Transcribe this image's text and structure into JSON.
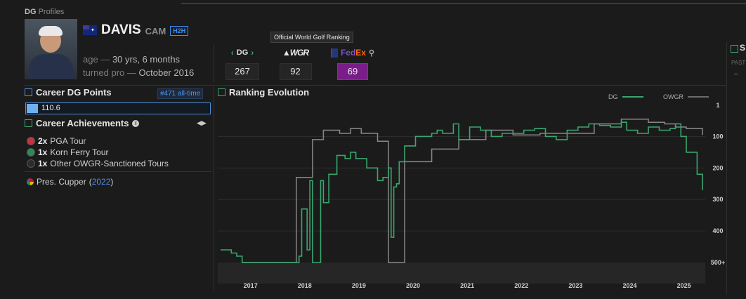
{
  "breadcrumb": {
    "prefix": "DG",
    "label": "Profiles"
  },
  "player": {
    "last_name": "DAVIS",
    "first_name": "CAM",
    "h2h_label": "H2H",
    "age_label": "age",
    "age_value": "30 yrs, 6 months",
    "pro_label": "turned pro",
    "pro_value": "October 2016"
  },
  "tooltip": "Official World Golf Ranking",
  "rankings": {
    "dg": {
      "label": "DG",
      "value": "267"
    },
    "owgr": {
      "label": "WGR",
      "value": "92"
    },
    "fedex": {
      "label_fe": "Fed",
      "label_ex": "Ex",
      "value": "69",
      "color": "#7a1d8a"
    }
  },
  "right_stub": {
    "title": "S",
    "past": "PAST",
    "dash": "–"
  },
  "career_points": {
    "title": "Career DG Points",
    "rank": "#471 all-time",
    "value": "110.6",
    "fill_fraction": 0.06
  },
  "achievements": {
    "title": "Career Achievements",
    "items": [
      {
        "count": "2x",
        "label": "PGA Tour",
        "color": "#c8323a"
      },
      {
        "count": "1x",
        "label": "Korn Ferry Tour",
        "color": "#2e8b57"
      },
      {
        "count": "1x",
        "label": "Other OWGR-Sanctioned Tours",
        "color": "#2c2c2c"
      }
    ],
    "cupper": {
      "label": "Pres. Cupper",
      "year": "2022"
    }
  },
  "ranking_evolution": {
    "title": "Ranking Evolution"
  },
  "chart_data": {
    "type": "line",
    "title": "Ranking Evolution",
    "x_ticks": [
      "2017",
      "2018",
      "2019",
      "2020",
      "2021",
      "2022",
      "2023",
      "2024",
      "2025"
    ],
    "y_ticks": [
      "1",
      "100",
      "200",
      "300",
      "400",
      "500+"
    ],
    "ylim": [
      1,
      500
    ],
    "y_inverted": true,
    "legend": "top-right",
    "series": [
      {
        "name": "DG",
        "color": "#3aa66e",
        "x": [
          2016.6,
          2016.8,
          2016.9,
          2017.0,
          2017.3,
          2017.6,
          2017.9,
          2018.0,
          2018.05,
          2018.1,
          2018.2,
          2018.25,
          2018.3,
          2018.45,
          2018.5,
          2018.6,
          2018.75,
          2018.9,
          2019.0,
          2019.1,
          2019.3,
          2019.5,
          2019.6,
          2019.7,
          2019.75,
          2019.8,
          2019.85,
          2019.9,
          2020.0,
          2020.2,
          2020.5,
          2020.6,
          2020.7,
          2020.9,
          2021.0,
          2021.2,
          2021.4,
          2021.6,
          2021.8,
          2022.0,
          2022.2,
          2022.4,
          2022.6,
          2022.8,
          2023.0,
          2023.2,
          2023.4,
          2023.6,
          2023.8,
          2024.0,
          2024.1,
          2024.3,
          2024.5,
          2024.7,
          2024.9,
          2025.0,
          2025.1,
          2025.2,
          2025.3,
          2025.4,
          2025.5
        ],
        "y": [
          460,
          470,
          480,
          500,
          500,
          500,
          500,
          500,
          480,
          330,
          460,
          240,
          500,
          240,
          310,
          220,
          160,
          170,
          150,
          170,
          200,
          240,
          230,
          200,
          420,
          260,
          250,
          180,
          130,
          100,
          90,
          80,
          90,
          60,
          110,
          70,
          80,
          100,
          90,
          90,
          80,
          75,
          100,
          110,
          80,
          70,
          60,
          65,
          70,
          55,
          80,
          90,
          70,
          80,
          75,
          60,
          100,
          150,
          150,
          220,
          270
        ]
      },
      {
        "name": "OWGR",
        "color": "#888888",
        "x": [
          2017.0,
          2017.6,
          2017.9,
          2018.0,
          2018.3,
          2018.5,
          2018.8,
          2019.0,
          2019.2,
          2019.5,
          2019.7,
          2019.8,
          2019.9,
          2020.0,
          2020.5,
          2021.0,
          2021.5,
          2022.0,
          2022.5,
          2023.0,
          2023.5,
          2024.0,
          2024.5,
          2024.8,
          2025.0,
          2025.2,
          2025.5
        ],
        "y": [
          500,
          500,
          500,
          230,
          110,
          80,
          90,
          75,
          90,
          115,
          500,
          500,
          500,
          180,
          140,
          110,
          80,
          95,
          90,
          90,
          60,
          45,
          55,
          60,
          70,
          75,
          95
        ]
      }
    ]
  }
}
